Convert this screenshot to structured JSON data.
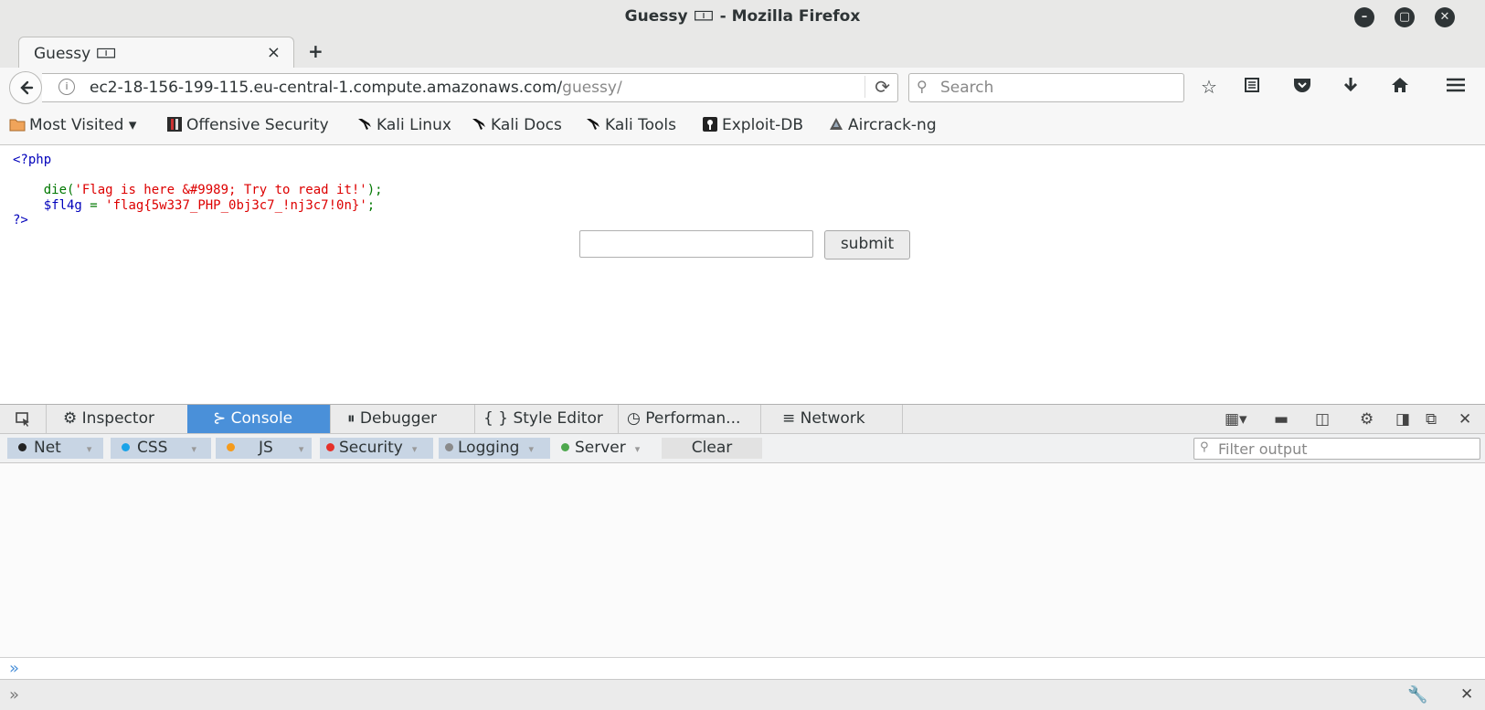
{
  "window": {
    "title": "Guessy 🀱 - Mozilla Firefox",
    "controls": [
      "minimize",
      "maximize",
      "close"
    ]
  },
  "tab": {
    "label": "Guessy 🀱",
    "close_glyph": "×",
    "new_tab_glyph": "+"
  },
  "navbar": {
    "url_host": "ec2-18-156-199-115.eu-central-1.compute.amazonaws.com/",
    "url_path": "guessy/",
    "search_placeholder": "Search"
  },
  "bookmarks": [
    {
      "label": "Most Visited ▾",
      "icon": "folder-icon"
    },
    {
      "label": "Offensive Security",
      "icon": "offsec-icon"
    },
    {
      "label": "Kali Linux",
      "icon": "kali-dragon-icon"
    },
    {
      "label": "Kali Docs",
      "icon": "kali-dragon-icon"
    },
    {
      "label": "Kali Tools",
      "icon": "kali-dragon-icon"
    },
    {
      "label": "Exploit-DB",
      "icon": "exploitdb-icon"
    },
    {
      "label": "Aircrack-ng",
      "icon": "aircrack-icon"
    }
  ],
  "page": {
    "code_open": "<?php",
    "code_die_fn": "die(",
    "code_die_str": "'Flag is here &#9989; Try to read it!'",
    "code_die_end": ");",
    "code_var": "$fl4g",
    "code_assign": " = ",
    "code_flag_str": "'flag{5w337_PHP_0bj3c7_!nj3c7!0n}'",
    "code_semicolon": ";",
    "code_close": "?>",
    "submit_label": "submit",
    "input_value": ""
  },
  "devtools": {
    "tabs": [
      {
        "label": "Inspector",
        "icon": "inspector-icon",
        "active": false
      },
      {
        "label": "Console",
        "icon": "console-icon",
        "active": true
      },
      {
        "label": "Debugger",
        "icon": "debugger-icon",
        "active": false
      },
      {
        "label": "Style Editor",
        "icon": "style-editor-icon",
        "active": false
      },
      {
        "label": "Performan...",
        "icon": "performance-icon",
        "active": false
      },
      {
        "label": "Network",
        "icon": "network-icon",
        "active": false
      }
    ],
    "filters": [
      {
        "label": "Net",
        "color": "#222222",
        "on": true
      },
      {
        "label": "CSS",
        "color": "#1aa3e8",
        "on": true
      },
      {
        "label": "JS",
        "color": "#f59b1c",
        "on": true
      },
      {
        "label": "Security",
        "color": "#e5312b",
        "on": true
      },
      {
        "label": "Logging",
        "color": "#8a8a8a",
        "on": true
      },
      {
        "label": "Server",
        "color": "#4ea84e",
        "on": false
      }
    ],
    "clear_label": "Clear",
    "filter_placeholder": "Filter output",
    "prompt_glyph": "»"
  },
  "colors": {
    "active_tab": "#4a90d9",
    "php_tag": "#0000bb",
    "php_fn": "#007700",
    "php_str": "#dd0000"
  }
}
